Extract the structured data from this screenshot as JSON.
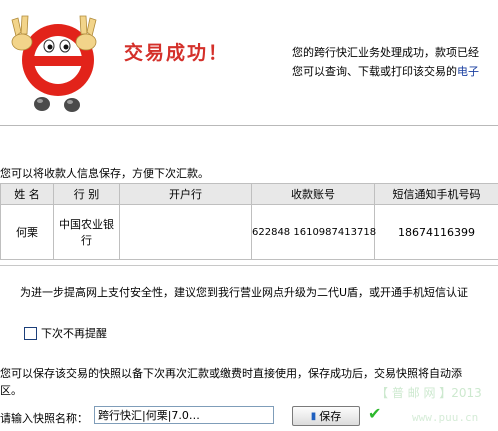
{
  "header": {
    "title": "交易成功！",
    "message_line1": "您的跨行快汇业务处理成功，款项已经",
    "message_line2_prefix": "您可以查询、下载或打印该交易的",
    "message_line2_link": "电子"
  },
  "save_hint": "您可以将收款人信息保存，方便下次汇款。",
  "table": {
    "headers": [
      "姓  名",
      "行  别",
      "开户行",
      "收款账号",
      "短信通知手机号码"
    ],
    "row": {
      "name": "何栗",
      "bank": "中国农业银行",
      "branch": "",
      "account": "622848 1610987413718",
      "phone": "18674116399"
    }
  },
  "security_note": "为进一步提高网上支付安全性，建议您到我行营业网点升级为二代U盾，或开通手机短信认证",
  "no_remind_label": "下次不再提醒",
  "snapshot_note_line1": "您可以保存该交易的快照以备下次再次汇款或缴费时直接使用，保存成功后，交易快照将自动添",
  "snapshot_note_line2": "区。",
  "snapshot": {
    "label": "请输入快照名称：",
    "value": "跨行快汇|何栗|7.0…",
    "save_button": "保存"
  },
  "watermark": {
    "line1": "【 普 邮 网 】2013",
    "line2": "www.puu.cn"
  },
  "colors": {
    "title_red": "#d4302a",
    "link_blue": "#1a3fa0",
    "check_green": "#2db82d"
  }
}
